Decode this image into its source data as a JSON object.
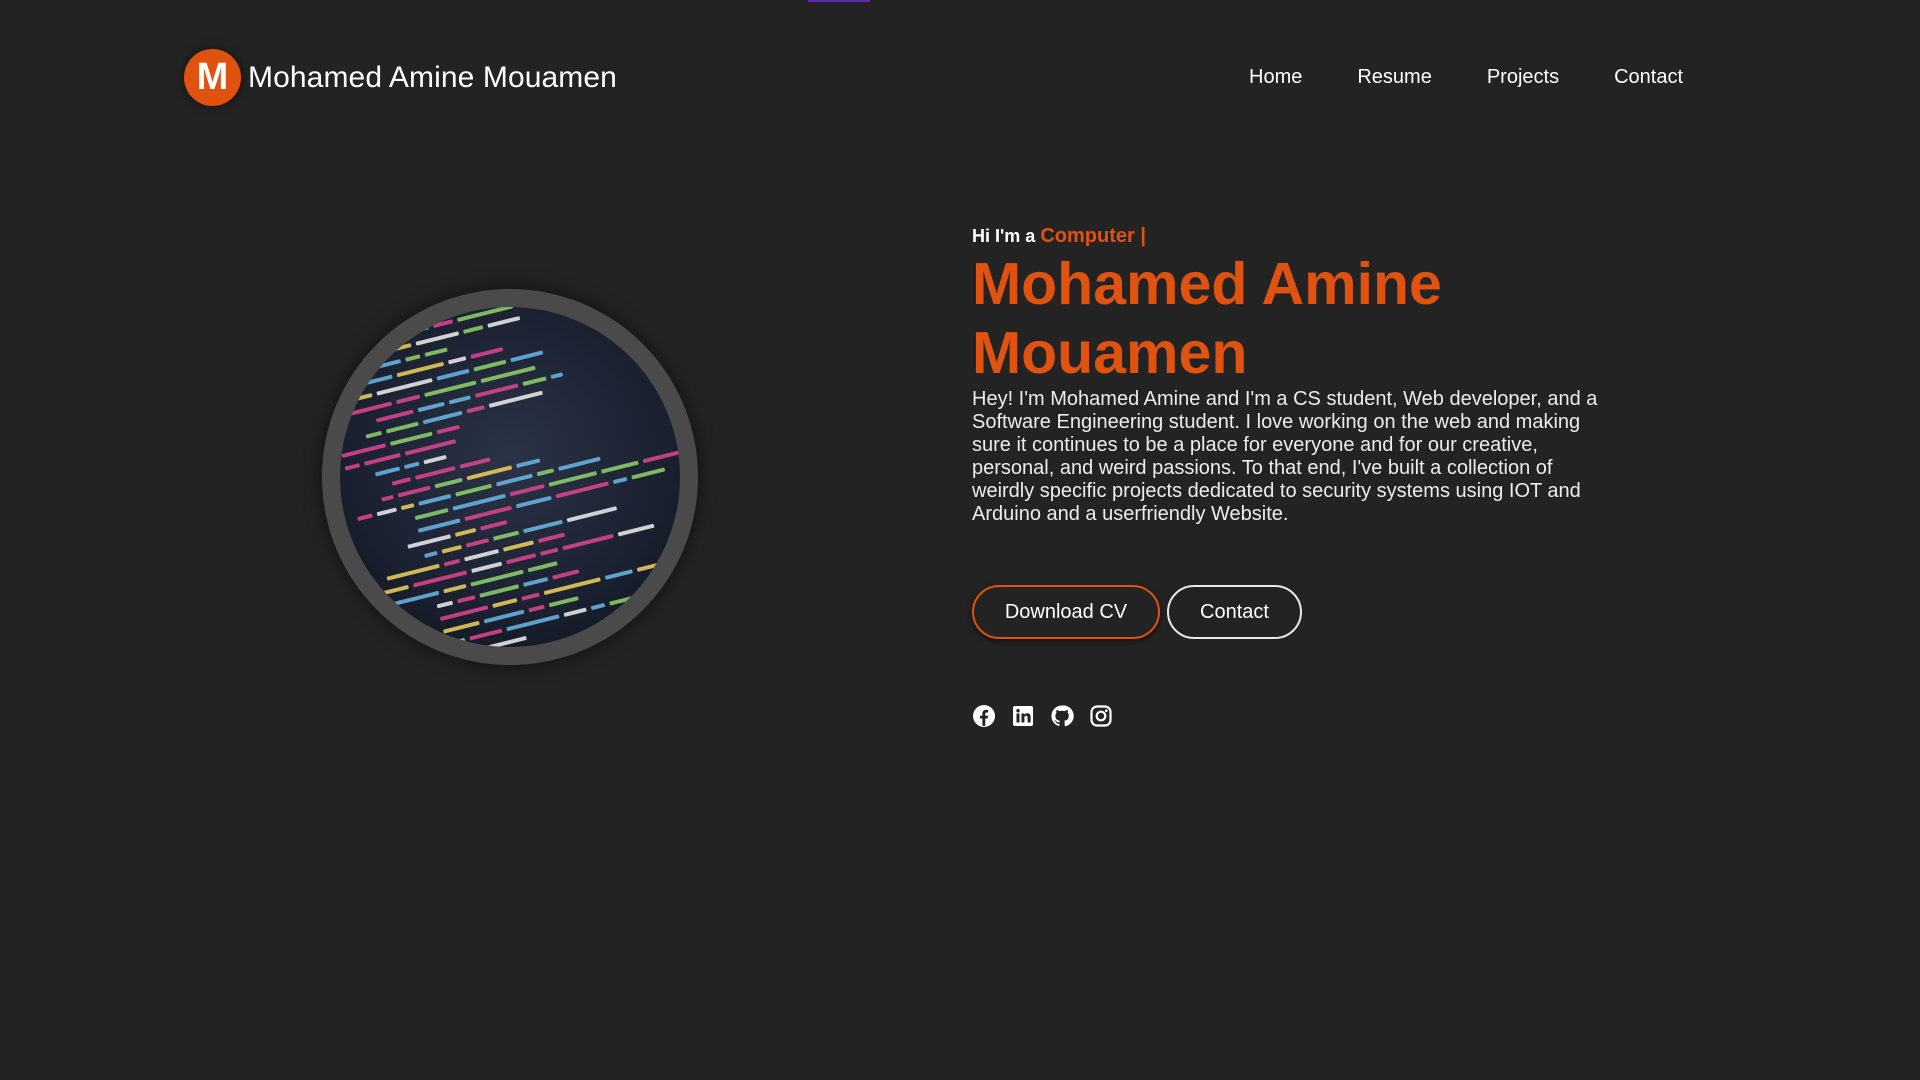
{
  "brand": {
    "logo_letter": "M",
    "name": "Mohamed Amine Mouamen",
    "accent_color": "#e0520f"
  },
  "nav": {
    "items": [
      {
        "label": "Home"
      },
      {
        "label": "Resume"
      },
      {
        "label": "Projects"
      },
      {
        "label": "Contact"
      }
    ]
  },
  "hero": {
    "image_icon": "code-screen-photo",
    "greeting": "Hi I'm a",
    "typed_text": "Computer |",
    "name": "Mohamed Amine Mouamen",
    "bio": "Hey! I'm Mohamed Amine and I'm a CS student, Web developer, and a Software Engineering student. I love working on the web and making sure it continues to be a place for everyone and for our creative, personal, and weird passions. To that end, I've built a collection of weirdly specific projects dedicated to security systems using IOT and Arduino and a userfriendly Website.",
    "buttons": {
      "download_cv": "Download CV",
      "contact": "Contact"
    },
    "socials": [
      {
        "icon": "facebook-icon"
      },
      {
        "icon": "linkedin-icon"
      },
      {
        "icon": "github-icon"
      },
      {
        "icon": "instagram-icon"
      }
    ]
  },
  "colors": {
    "background": "#232323",
    "accent": "#e0520f",
    "text": "#ffffff"
  }
}
